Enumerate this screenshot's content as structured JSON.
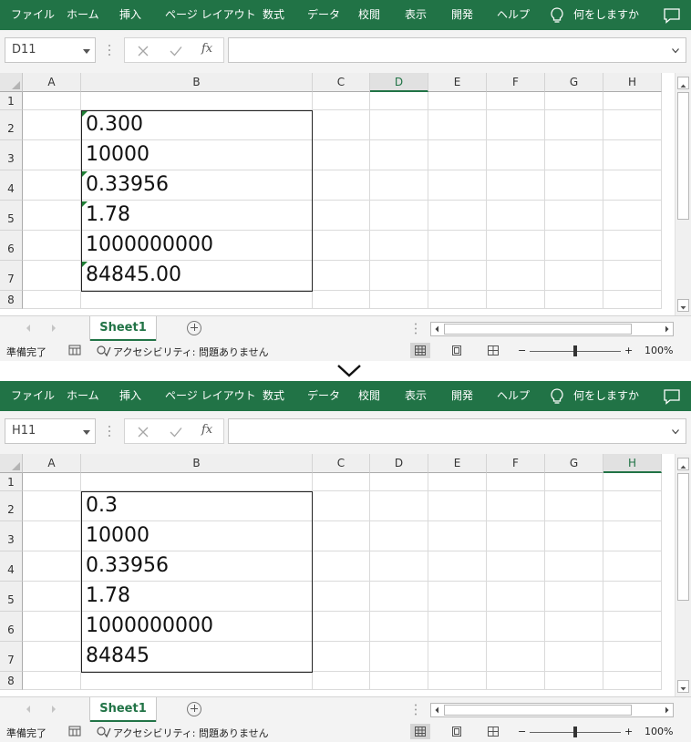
{
  "ribbon_tabs": [
    "ファイル",
    "ホーム",
    "挿入",
    "ページ レイアウト",
    "数式",
    "データ",
    "校閲",
    "表示",
    "開発",
    "ヘルプ"
  ],
  "tell_me": "何をしますか",
  "formula_bar": {
    "fx_label": "fx",
    "formula": ""
  },
  "columns": [
    "A",
    "B",
    "C",
    "D",
    "E",
    "F",
    "G",
    "H"
  ],
  "rows": [
    "1",
    "2",
    "3",
    "4",
    "5",
    "6",
    "7",
    "8"
  ],
  "sheet_tab": "Sheet1",
  "status": {
    "ready": "準備完了",
    "accessibility": "アクセシビリティ: 問題ありません",
    "zoom": "100%",
    "zoom_minus": "−",
    "zoom_plus": "+"
  },
  "before": {
    "name_box": "D11",
    "selected_column": "D",
    "cells_B": [
      "0.300",
      "10000",
      "0.33956",
      "1.78",
      "1000000000",
      "84845.00"
    ],
    "text_number_error_rows": [
      "2",
      "4",
      "5",
      "7"
    ]
  },
  "after": {
    "name_box": "H11",
    "selected_column": "H",
    "cells_B": [
      "0.3",
      "10000",
      "0.33956",
      "1.78",
      "1000000000",
      "84845"
    ],
    "text_number_error_rows": []
  },
  "icons": {
    "divider": "chevron-down-icon",
    "tell_me": "lightbulb-icon",
    "comment": "comment-icon",
    "cancel": "close-icon",
    "enter": "check-icon",
    "add_sheet": "plus-circle-icon"
  },
  "colors": {
    "ribbon": "#217346",
    "error_indicator": "#1e7e34"
  }
}
